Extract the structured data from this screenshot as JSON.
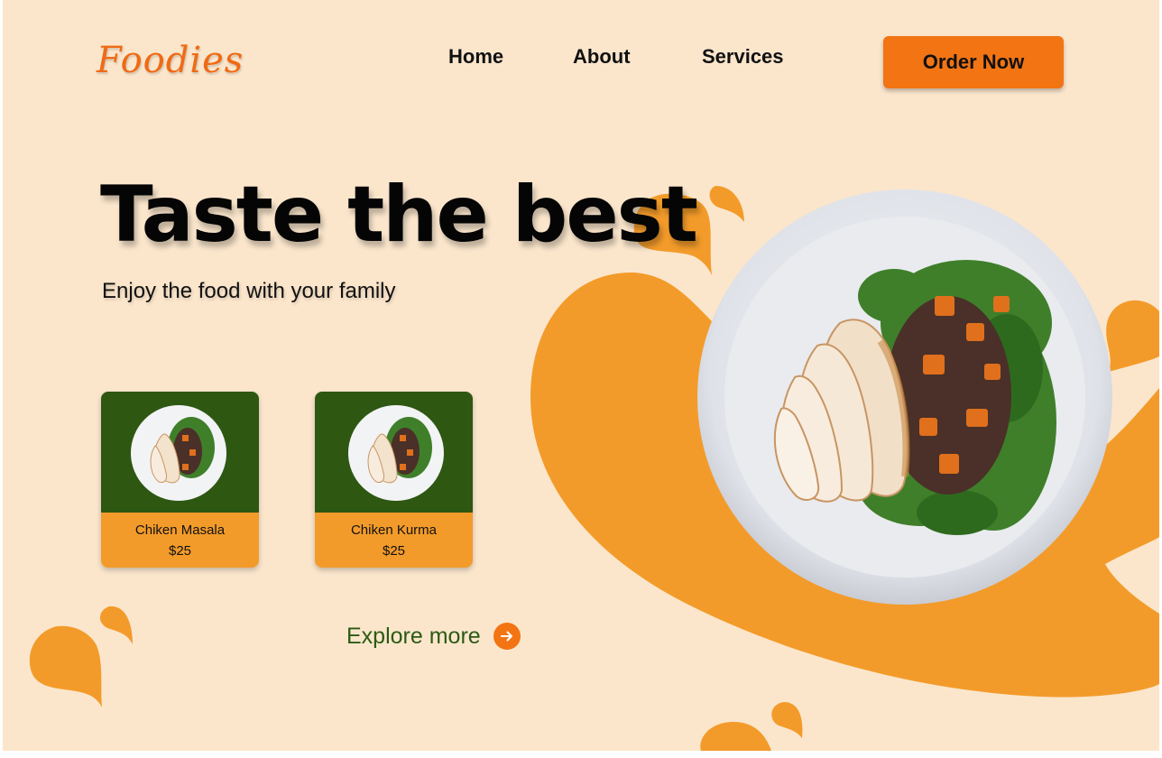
{
  "brand": {
    "logo_text": "Foodies"
  },
  "nav": {
    "items": [
      {
        "label": "Home"
      },
      {
        "label": "About"
      },
      {
        "label": "Services"
      }
    ],
    "cta_label": "Order Now"
  },
  "hero": {
    "title": "Taste the best",
    "subtitle": "Enjoy the food with your family"
  },
  "cards": [
    {
      "name": "Chiken Masala",
      "price": "$25",
      "image": "chicken-salad-plate"
    },
    {
      "name": "Chiken Kurma",
      "price": "$25",
      "image": "chicken-salad-plate"
    }
  ],
  "explore": {
    "label": "Explore more",
    "icon": "arrow-right-circle-icon"
  },
  "colors": {
    "background": "#fbe6cc",
    "accent_orange": "#f37413",
    "splash_orange": "#f39b2a",
    "card_green": "#2e5712",
    "explore_text": "#2c5a14"
  }
}
